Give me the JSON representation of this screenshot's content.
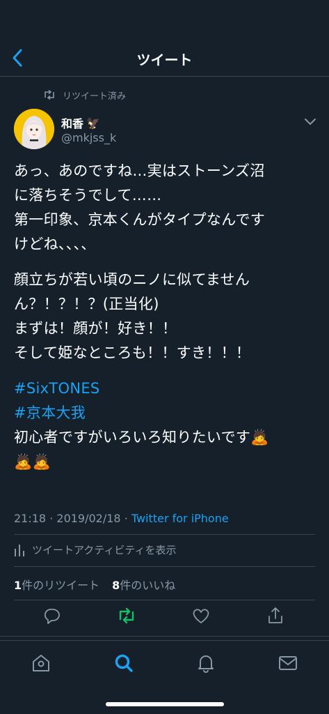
{
  "header": {
    "title": "ツイート",
    "back_icon": "back-chevron-icon"
  },
  "retweet_indicator": {
    "label": "リツイート済み"
  },
  "author": {
    "name": "和香",
    "name_emoji": "🦅",
    "handle": "@mkjss_k"
  },
  "tweet": {
    "lines": [
      "あっ、あのですね…実はストーンズ沼",
      "に落ちそうでして……",
      "第一印象、京本くんがタイプなんです",
      "けどね、、、、",
      "顔立ちが若い頃のニノに似てません",
      "ん？！？！？(正当化)",
      "まずは！顔が！好き！！",
      "そして姫なところも！！すき！！！"
    ],
    "hashtags": [
      "#SixTONES",
      "#京本大我"
    ],
    "closing": "初心者ですがいろいろ知りたいです🙇",
    "closing_emoji": "🙇🙇"
  },
  "meta": {
    "time": "21:18",
    "date": "2019/02/18",
    "sep": "·",
    "source": "Twitter for iPhone"
  },
  "activity": {
    "label": "ツイートアクティビティを表示"
  },
  "counts": {
    "retweets_num": "1",
    "retweets_label": "件のリツイート",
    "likes_num": "8",
    "likes_label": "件のいいね"
  },
  "colors": {
    "background": "#15202b",
    "accent": "#1da1f2",
    "retweet_green": "#17bf63",
    "muted": "#8899a6",
    "divider": "#38444d"
  },
  "tabs": [
    "home-icon",
    "search-icon",
    "notifications-icon",
    "messages-icon"
  ],
  "active_tab": "search-icon"
}
